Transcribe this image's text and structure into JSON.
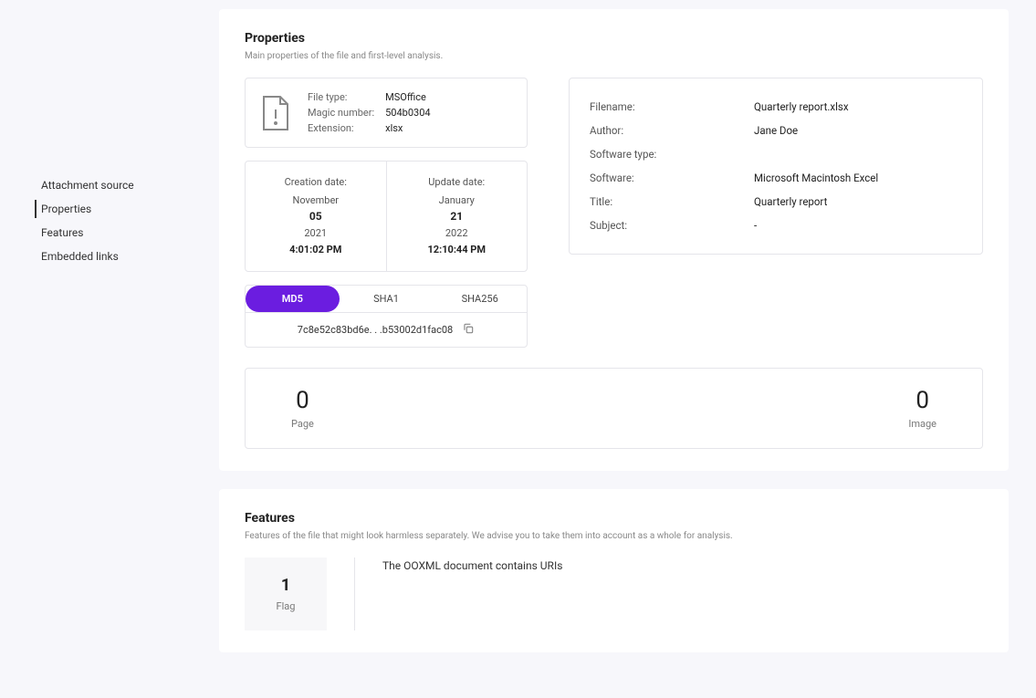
{
  "sidebar": {
    "items": [
      {
        "label": "Attachment source"
      },
      {
        "label": "Properties"
      },
      {
        "label": "Features"
      },
      {
        "label": "Embedded links"
      }
    ]
  },
  "properties": {
    "title": "Properties",
    "subtitle": "Main properties of the file and first-level analysis.",
    "filetype": {
      "file_type_k": "File type:",
      "file_type_v": "MSOffice",
      "magic_k": "Magic number:",
      "magic_v": "504b0304",
      "ext_k": "Extension:",
      "ext_v": "xlsx"
    },
    "creation": {
      "label": "Creation date:",
      "month": "November",
      "day": "05",
      "year": "2021",
      "time": "4:01:02 PM"
    },
    "update": {
      "label": "Update date:",
      "month": "January",
      "day": "21",
      "year": "2022",
      "time": "12:10:44 PM"
    },
    "hash": {
      "tabs": {
        "md5": "MD5",
        "sha1": "SHA1",
        "sha256": "SHA256"
      },
      "value": "7c8e52c83bd6e. . .b53002d1fac08"
    },
    "meta": {
      "filename_k": "Filename:",
      "filename_v": "Quarterly report.xlsx",
      "author_k": "Author:",
      "author_v": "Jane Doe",
      "swtype_k": "Software type:",
      "swtype_v": "",
      "software_k": "Software:",
      "software_v": "Microsoft Macintosh Excel",
      "title_k": "Title:",
      "title_v": "Quarterly report",
      "subject_k": "Subject:",
      "subject_v": "-"
    },
    "stats": {
      "page_n": "0",
      "page_l": "Page",
      "image_n": "0",
      "image_l": "Image"
    }
  },
  "features": {
    "title": "Features",
    "subtitle": "Features of the file that might look harmless separately. We advise you to take them into account as a whole for analysis.",
    "flag_n": "1",
    "flag_l": "Flag",
    "item": "The OOXML document contains URIs"
  }
}
